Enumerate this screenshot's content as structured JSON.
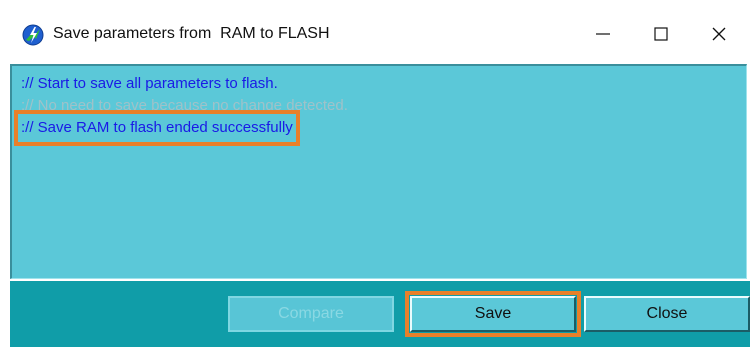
{
  "window": {
    "title": "Save parameters from  RAM to FLASH",
    "app_icon": "blue-lightning-app-icon"
  },
  "title_controls": {
    "minimize_label": "—",
    "maximize_label": "☐",
    "close_label": "✕"
  },
  "log": {
    "lines": [
      {
        "text": ":// Start to save all parameters to flash.",
        "style": "blue"
      },
      {
        "text": ":// No need to save because no change detected.",
        "style": "grey"
      },
      {
        "text": ":// Save RAM to flash ended successfully",
        "style": "blue",
        "highlighted": true
      }
    ]
  },
  "buttons": {
    "compare_label": "Compare",
    "save_label": "Save",
    "close_label": "Close"
  },
  "colors": {
    "log_background": "#5bc8d8",
    "bottom_bar": "#109da8",
    "log_text_blue": "#1a1ae6",
    "log_text_grey": "#9fc2c9",
    "highlight_orange": "#e8802a"
  }
}
